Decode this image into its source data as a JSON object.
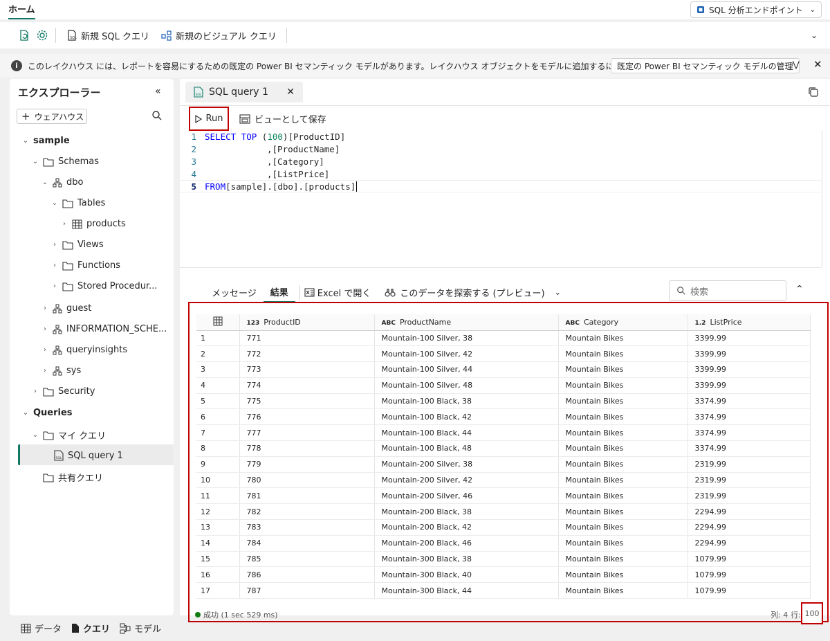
{
  "top": {
    "home_tab": "ホーム",
    "endpoint_label": "SQL 分析エンドポイント"
  },
  "toolbar": {
    "new_sql_query": "新規 SQL クエリ",
    "new_visual_query": "新規のビジュアル クエリ"
  },
  "info": {
    "message": "このレイクハウス には、レポートを容易にするための既定の Power BI セマンティック モデルがあります。レイクハウス オブジェクトをモデルに追加するには...",
    "manage_button": "既定の Power BI セマンティック モデルの管理"
  },
  "explorer": {
    "title": "エクスプローラー",
    "warehouse_button": "ウェアハウス",
    "tree": [
      {
        "label": "sample"
      },
      {
        "label": "Schemas"
      },
      {
        "label": "dbo"
      },
      {
        "label": "Tables"
      },
      {
        "label": "products"
      },
      {
        "label": "Views"
      },
      {
        "label": "Functions"
      },
      {
        "label": "Stored Procedur..."
      },
      {
        "label": "guest"
      },
      {
        "label": "INFORMATION_SCHE..."
      },
      {
        "label": "queryinsights"
      },
      {
        "label": "sys"
      },
      {
        "label": "Security"
      },
      {
        "label": "Queries"
      },
      {
        "label": "マイ クエリ"
      },
      {
        "label": "SQL query 1"
      },
      {
        "label": "共有クエリ"
      }
    ]
  },
  "editor": {
    "tab_title": "SQL query 1",
    "run_label": "Run",
    "save_view_label": "ビューとして保存",
    "code": {
      "l1_kw1": "SELECT",
      "l1_kw2": "TOP",
      "l1_num": "100",
      "l1_rest": " [ProductID]",
      "l2": ",[ProductName]",
      "l3": ",[Category]",
      "l4": ",[ListPrice]",
      "l5_kw": "FROM",
      "l5_rest": " [sample].[dbo].[products]"
    }
  },
  "results": {
    "tab_messages": "メッセージ",
    "tab_results": "結果",
    "open_excel": "Excel で開く",
    "explore_data": "このデータを探索する (プレビュー)",
    "search_placeholder": "検索",
    "columns": [
      {
        "type": "123",
        "name": "ProductID"
      },
      {
        "type": "ABC",
        "name": "ProductName"
      },
      {
        "type": "ABC",
        "name": "Category"
      },
      {
        "type": "1.2",
        "name": "ListPrice"
      }
    ],
    "rows": [
      [
        "1",
        "771",
        "Mountain-100 Silver, 38",
        "Mountain Bikes",
        "3399.99"
      ],
      [
        "2",
        "772",
        "Mountain-100 Silver, 42",
        "Mountain Bikes",
        "3399.99"
      ],
      [
        "3",
        "773",
        "Mountain-100 Silver, 44",
        "Mountain Bikes",
        "3399.99"
      ],
      [
        "4",
        "774",
        "Mountain-100 Silver, 48",
        "Mountain Bikes",
        "3399.99"
      ],
      [
        "5",
        "775",
        "Mountain-100 Black, 38",
        "Mountain Bikes",
        "3374.99"
      ],
      [
        "6",
        "776",
        "Mountain-100 Black, 42",
        "Mountain Bikes",
        "3374.99"
      ],
      [
        "7",
        "777",
        "Mountain-100 Black, 44",
        "Mountain Bikes",
        "3374.99"
      ],
      [
        "8",
        "778",
        "Mountain-100 Black, 48",
        "Mountain Bikes",
        "3374.99"
      ],
      [
        "9",
        "779",
        "Mountain-200 Silver, 38",
        "Mountain Bikes",
        "2319.99"
      ],
      [
        "10",
        "780",
        "Mountain-200 Silver, 42",
        "Mountain Bikes",
        "2319.99"
      ],
      [
        "11",
        "781",
        "Mountain-200 Silver, 46",
        "Mountain Bikes",
        "2319.99"
      ],
      [
        "12",
        "782",
        "Mountain-200 Black, 38",
        "Mountain Bikes",
        "2294.99"
      ],
      [
        "13",
        "783",
        "Mountain-200 Black, 42",
        "Mountain Bikes",
        "2294.99"
      ],
      [
        "14",
        "784",
        "Mountain-200 Black, 46",
        "Mountain Bikes",
        "2294.99"
      ],
      [
        "15",
        "785",
        "Mountain-300 Black, 38",
        "Mountain Bikes",
        "1079.99"
      ],
      [
        "16",
        "786",
        "Mountain-300 Black, 40",
        "Mountain Bikes",
        "1079.99"
      ],
      [
        "17",
        "787",
        "Mountain-300 Black, 44",
        "Mountain Bikes",
        "1079.99"
      ]
    ],
    "status": "成功 (1 sec 529 ms)",
    "col_label": "列: 4",
    "row_label": "行:",
    "row_count": "100"
  },
  "bottom_nav": {
    "data": "データ",
    "query": "クエリ",
    "model": "モデル"
  },
  "colors": {
    "accent": "#117865",
    "highlight_box": "#c00000",
    "success": "#107c10"
  }
}
